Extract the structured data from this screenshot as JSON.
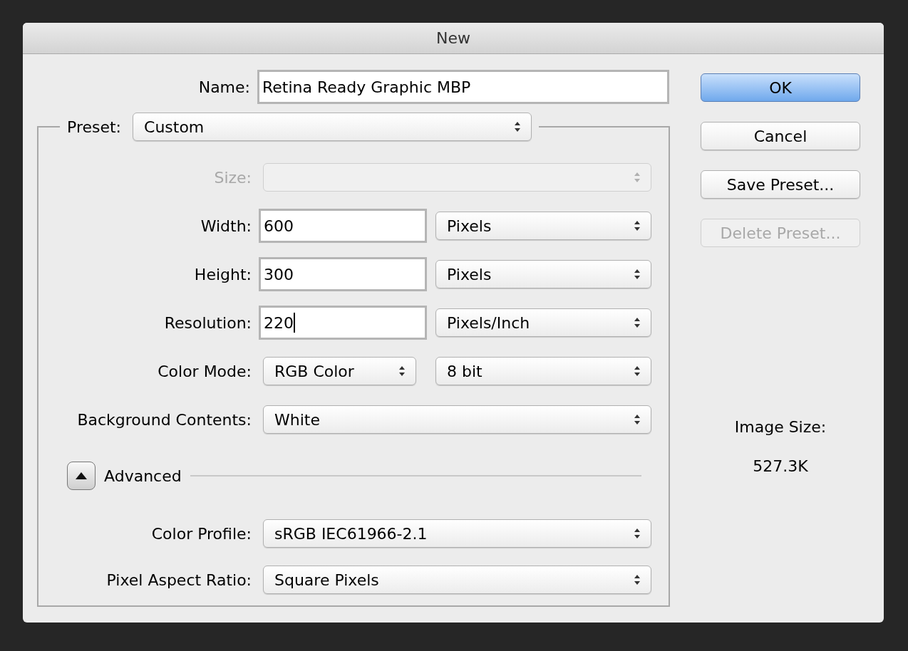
{
  "window": {
    "title": "New"
  },
  "name": {
    "label": "Name:",
    "value": "Retina Ready Graphic MBP"
  },
  "preset": {
    "label": "Preset:",
    "value": "Custom"
  },
  "rows": [
    {
      "label": "Size:",
      "disabled": true,
      "controls": [
        {
          "kind": "select"
        }
      ]
    },
    {
      "label": "Width:",
      "disabled": false,
      "controls": [
        {
          "kind": "input",
          "value": "600",
          "focused": false
        },
        {
          "kind": "select",
          "value": "Pixels"
        }
      ]
    },
    {
      "label": "Height:",
      "disabled": false,
      "controls": [
        {
          "kind": "input",
          "value": "300",
          "focused": false
        },
        {
          "kind": "select",
          "value": "Pixels"
        }
      ]
    },
    {
      "label": "Resolution:",
      "disabled": false,
      "controls": [
        {
          "kind": "input",
          "value": "220",
          "focused": true
        },
        {
          "kind": "select",
          "value": "Pixels/Inch"
        }
      ]
    },
    {
      "label": "Color Mode:",
      "disabled": false,
      "controls": [
        {
          "kind": "select",
          "value": "RGB Color"
        },
        {
          "kind": "select",
          "value": "8 bit"
        }
      ]
    },
    {
      "label": "Background Contents:",
      "disabled": false,
      "controls": [
        {
          "kind": "select",
          "value": "White"
        }
      ]
    }
  ],
  "advanced": {
    "label": "Advanced",
    "expanded": true
  },
  "advanced_rows": [
    {
      "label": "Color Profile:",
      "disabled": false,
      "controls": [
        {
          "kind": "select",
          "value": "sRGB IEC61966-2.1"
        }
      ]
    },
    {
      "label": "Pixel Aspect Ratio:",
      "disabled": false,
      "controls": [
        {
          "kind": "select",
          "value": "Square Pixels"
        }
      ]
    }
  ],
  "buttons": [
    {
      "label": "OK",
      "default": true,
      "disabled": false
    },
    {
      "label": "Cancel",
      "default": false,
      "disabled": false
    },
    {
      "label": "Save Preset...",
      "default": false,
      "disabled": false
    },
    {
      "label": "Delete Preset...",
      "default": false,
      "disabled": true
    }
  ],
  "image_size": {
    "label": "Image Size:",
    "value": "527.3K"
  }
}
